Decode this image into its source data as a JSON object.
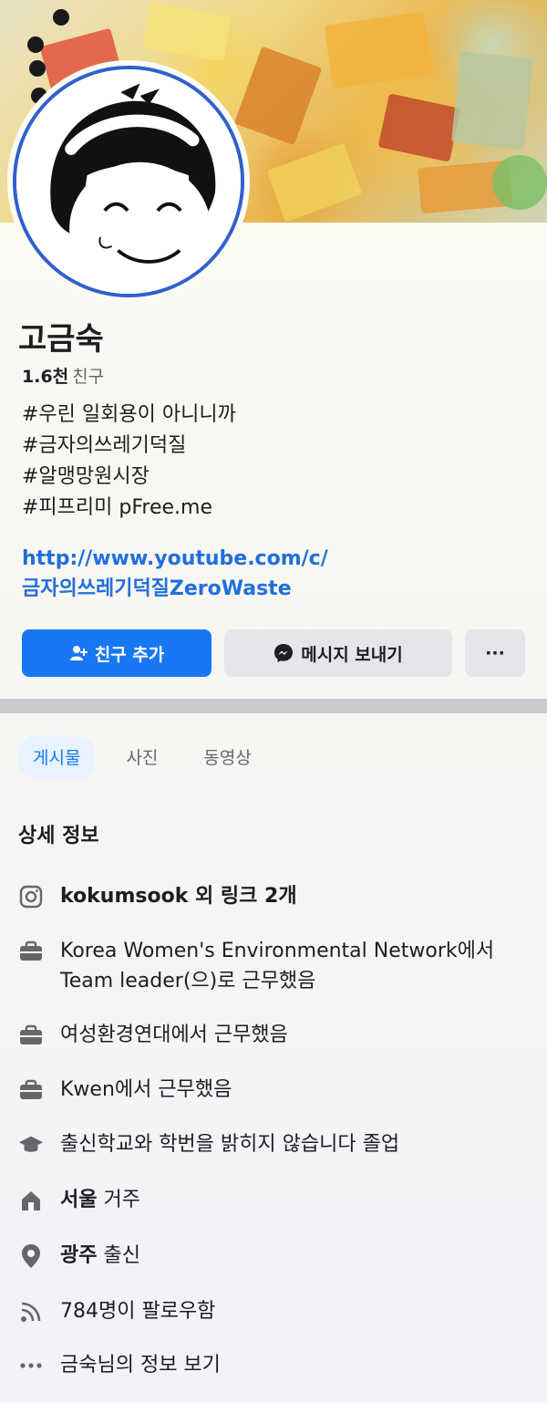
{
  "profile": {
    "name": "고금숙",
    "friends_count": "1.6천",
    "friends_label": "친구",
    "bio": [
      "#우린 일회용이 아니니까",
      "#금자의쓰레기덕질",
      "#알맹망원시장",
      "#피프리미  pFree.me"
    ],
    "link_line1": "http://www.youtube.com/c/",
    "link_line2": "금자의쓰레기덕질ZeroWaste"
  },
  "actions": {
    "add_friend": "친구 추가",
    "message": "메시지 보내기",
    "more": "···"
  },
  "tabs": [
    "게시물",
    "사진",
    "동영상"
  ],
  "details": {
    "title": "상세 정보",
    "instagram": "kokumsook 외 링크 2개",
    "work1": "Korea Women's Environmental Network에서 Team leader(으)로 근무했음",
    "work2": "여성환경연대에서 근무했음",
    "work3": "Kwen에서 근무했음",
    "education": "출신학교와 학번을 밝히지 않습니다 졸업",
    "lives_city": "서울",
    "lives_label": "거주",
    "from_city": "광주",
    "from_label": "출신",
    "followers": "784명이 팔로우함",
    "see_more": "금숙님의 정보 보기"
  },
  "colors": {
    "accent": "#1877f2",
    "link": "#216fdb",
    "avatar_ring": "#2f5fd0"
  },
  "icons": [
    "instagram-icon",
    "briefcase-icon",
    "graduation-cap-icon",
    "home-icon",
    "location-pin-icon",
    "rss-icon",
    "more-dots-icon",
    "add-friend-icon",
    "messenger-icon"
  ]
}
